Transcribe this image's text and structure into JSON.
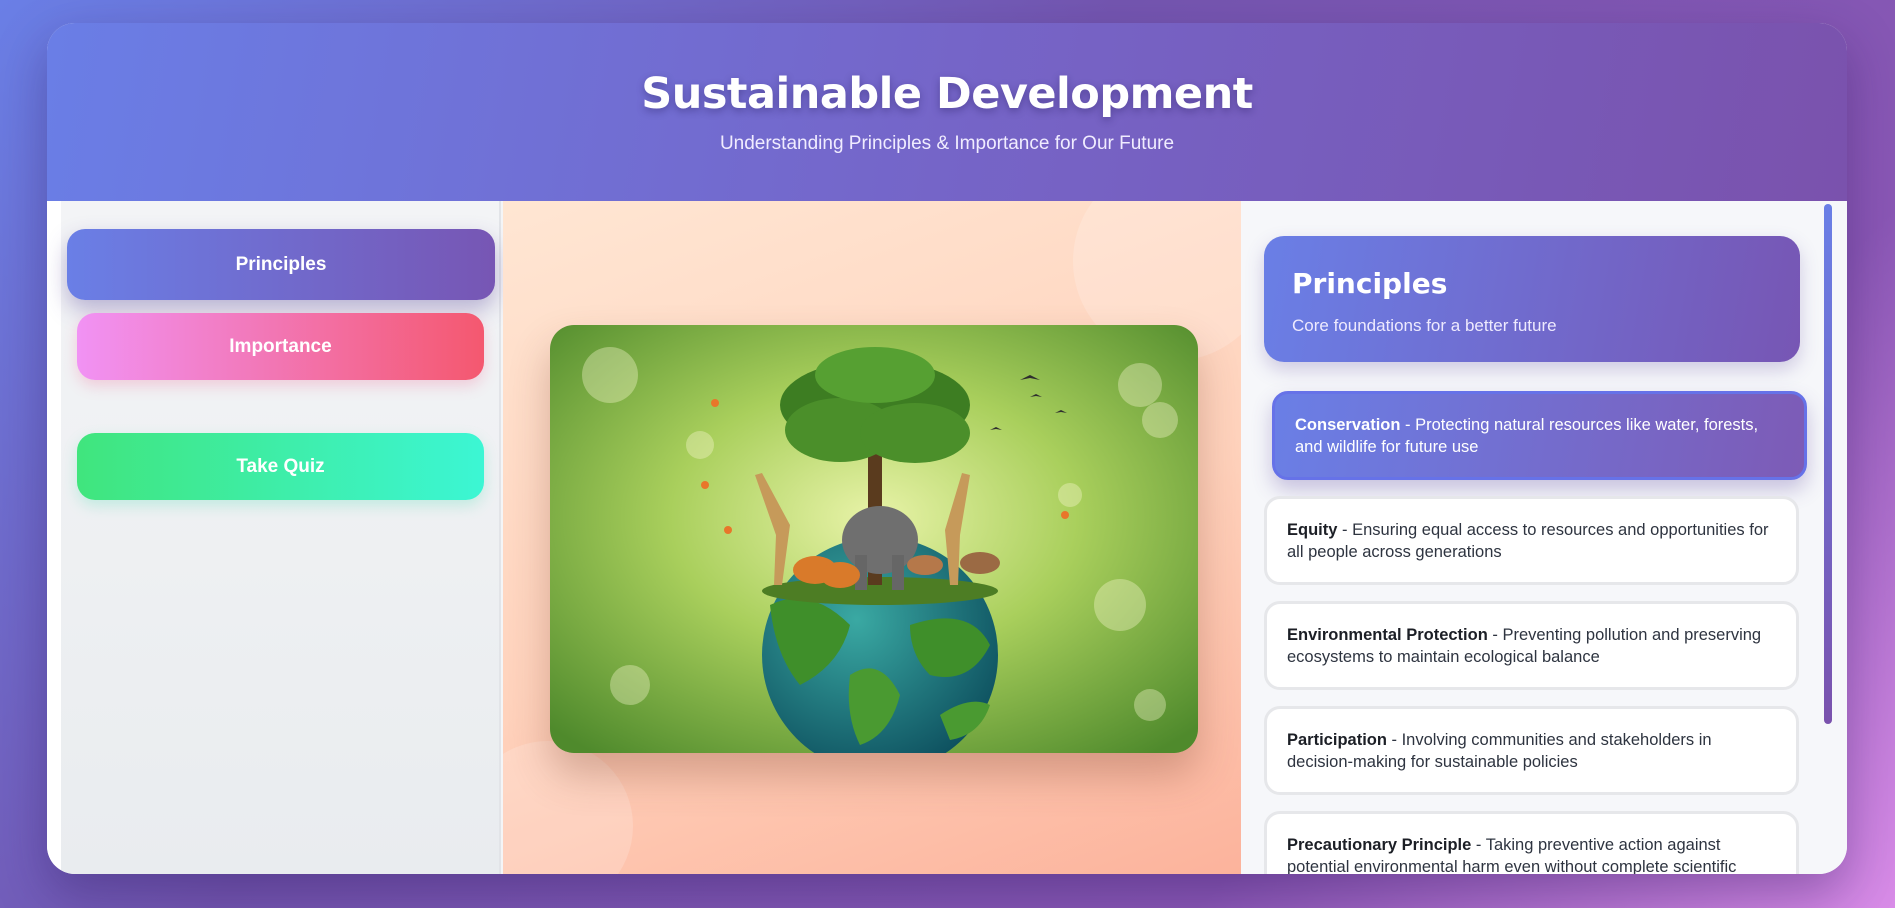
{
  "header": {
    "title": "Sustainable Development",
    "subtitle": "Understanding Principles & Importance for Our Future"
  },
  "sidebar": {
    "buttons": [
      {
        "label": "Principles",
        "active": true
      },
      {
        "label": "Importance",
        "active": false
      },
      {
        "label": "Take Quiz",
        "active": false
      }
    ]
  },
  "hero_image": {
    "description_icon": "earth-with-trees-and-animals-image"
  },
  "panel": {
    "title": "Principles",
    "subtitle": "Core foundations for a better future",
    "items": [
      {
        "term": "Conservation",
        "text": " - Protecting natural resources like water, forests, and wildlife for future use",
        "active": true
      },
      {
        "term": "Equity",
        "text": " - Ensuring equal access to resources and opportunities for all people across generations",
        "active": false
      },
      {
        "term": "Environmental Protection",
        "text": " - Preventing pollution and preserving ecosystems to maintain ecological balance",
        "active": false
      },
      {
        "term": "Participation",
        "text": " - Involving communities and stakeholders in decision-making for sustainable policies",
        "active": false
      },
      {
        "term": "Precautionary Principle",
        "text": " - Taking preventive action against potential environmental harm even without complete scientific",
        "active": false
      }
    ]
  },
  "colors": {
    "accent_start": "#6a7fe6",
    "accent_end": "#7756b4",
    "importance_start": "#f192f4",
    "importance_end": "#f4586f",
    "quiz_start": "#40e57d",
    "quiz_end": "#3cf6d4"
  }
}
